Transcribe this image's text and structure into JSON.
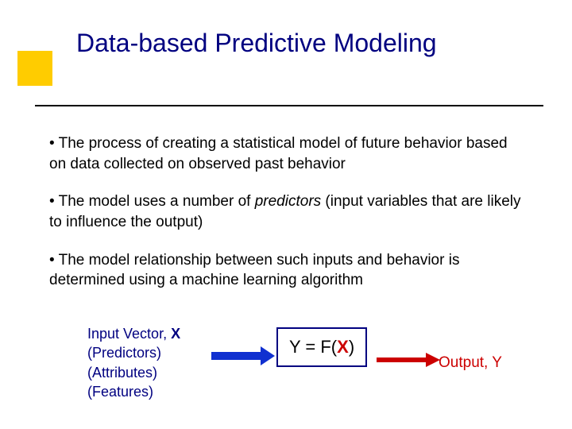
{
  "title": "Data-based Predictive Modeling",
  "bullets": {
    "b1_pre": "• The process of creating a statistical model of future behavior based on data collected on ",
    "b1_obs": "observed",
    "b1_post": " past behavior",
    "b2_pre": "• The model uses a number of ",
    "b2_pred": "predictors",
    "b2_post": " (input variables that are likely to influence the output)",
    "b3": "• The model relationship between such inputs and behavior is determined using a machine learning algorithm"
  },
  "diagram": {
    "input_line1_pre": "Input Vector, ",
    "input_line1_x": "X",
    "input_line2": "(Predictors)",
    "input_line3": "(Attributes)",
    "input_line4": "(Features)",
    "formula_pre": "Y = F(",
    "formula_x": "X",
    "formula_post": ")",
    "output": "Output, Y"
  }
}
